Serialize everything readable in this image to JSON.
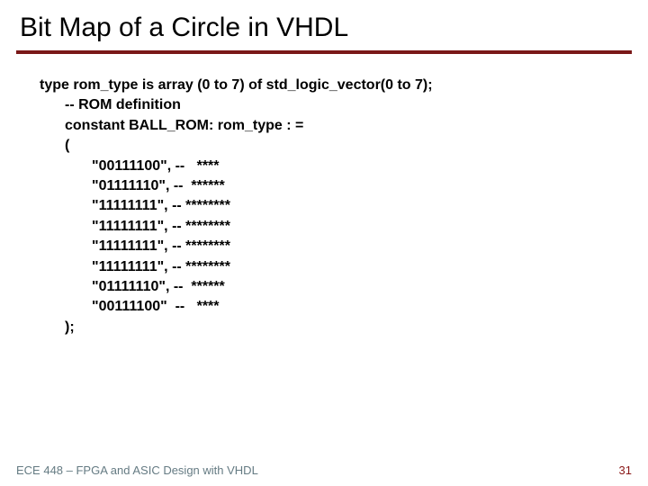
{
  "title": "Bit Map of a Circle in VHDL",
  "code": {
    "l0": "type rom_type is array (0 to 7) of std_logic_vector(0 to 7);",
    "l1": "-- ROM definition",
    "l2": "constant BALL_ROM: rom_type : =",
    "l3": "(",
    "l4": "\"00111100\", --   ****",
    "l5": "\"01111110\", --  ******",
    "l6": "\"11111111\", -- ********",
    "l7": "\"11111111\", -- ********",
    "l8": "\"11111111\", -- ********",
    "l9": "\"11111111\", -- ********",
    "l10": "\"01111110\", --  ******",
    "l11": "\"00111100\"  --   ****",
    "l12": ");"
  },
  "footer": {
    "left": "ECE 448 – FPGA and ASIC Design with VHDL",
    "right": "31"
  }
}
